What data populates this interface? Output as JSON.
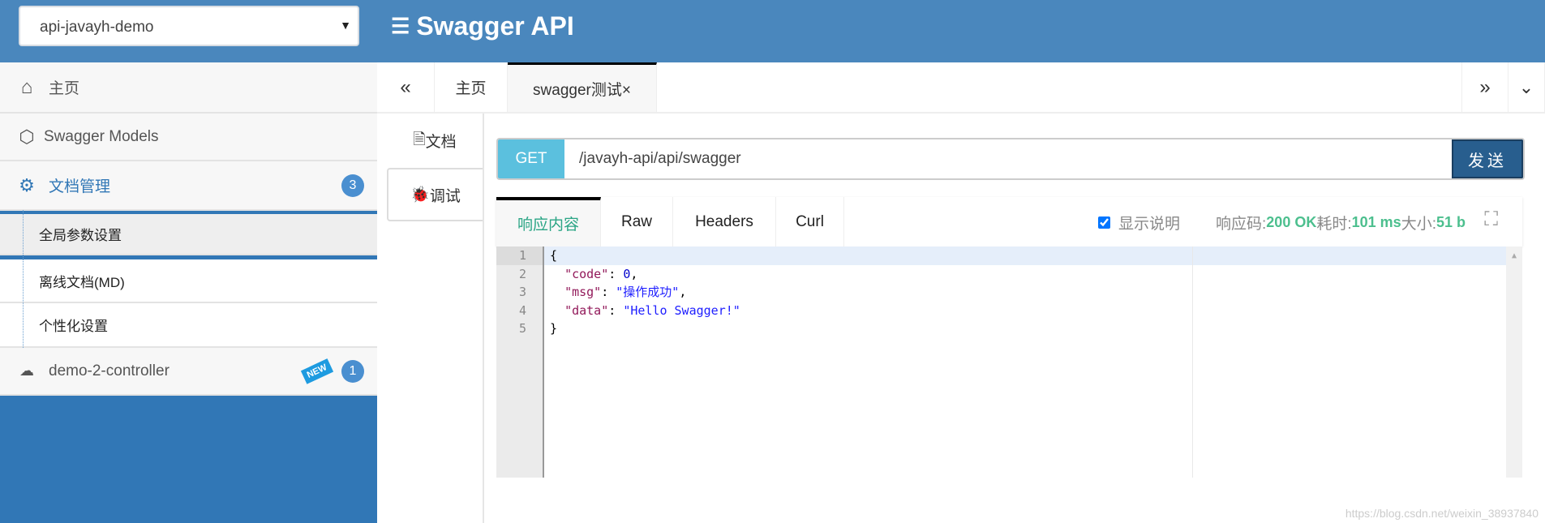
{
  "header": {
    "project_select": "api-javayh-demo",
    "brand": "Swagger API"
  },
  "sidebar": {
    "home": "主页",
    "models": "Swagger Models",
    "doc_manage": {
      "label": "文档管理",
      "count": "3"
    },
    "sub_items": [
      "全局参数设置",
      "离线文档(MD)",
      "个性化设置"
    ],
    "controller": {
      "label": "demo-2-controller",
      "new_badge": "NEW",
      "count": "1"
    }
  },
  "tabs": {
    "home": "主页",
    "active": "swagger测试×"
  },
  "side_tabs": {
    "doc": "文档",
    "debug": "调试"
  },
  "request": {
    "method": "GET",
    "url": "/javayh-api/api/swagger",
    "send": "发送"
  },
  "response": {
    "tabs": [
      "响应内容",
      "Raw",
      "Headers",
      "Curl"
    ],
    "show_desc": "显示说明",
    "code_label": "响应码:",
    "code": "200 OK",
    "time_label": "耗时:",
    "time": "101 ms",
    "size_label": "大小:",
    "size": "51 b",
    "lines": [
      "1",
      "2",
      "3",
      "4",
      "5"
    ],
    "body": {
      "code_key": "\"code\"",
      "code_val": "0",
      "msg_key": "\"msg\"",
      "msg_val": "\"操作成功\"",
      "data_key": "\"data\"",
      "data_val": "\"Hello Swagger!\""
    }
  },
  "watermark": "https://blog.csdn.net/weixin_38937840"
}
